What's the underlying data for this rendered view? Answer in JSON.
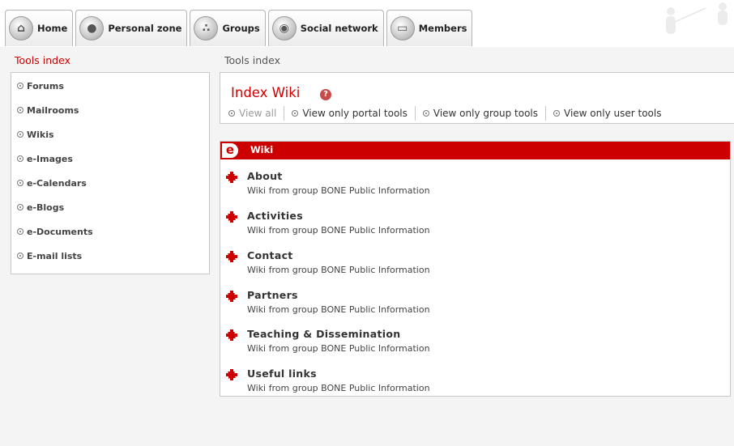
{
  "nav": {
    "tabs": [
      {
        "label": "Home",
        "icon": "home-icon"
      },
      {
        "label": "Personal zone",
        "icon": "user-icon"
      },
      {
        "label": "Groups",
        "icon": "groups-icon"
      },
      {
        "label": "Social network",
        "icon": "network-icon"
      },
      {
        "label": "Members",
        "icon": "members-icon"
      }
    ]
  },
  "sidebar": {
    "title": "Tools index",
    "items": [
      {
        "label": "Forums"
      },
      {
        "label": "Mailrooms"
      },
      {
        "label": "Wikis"
      },
      {
        "label": "e-Images"
      },
      {
        "label": "e-Calendars"
      },
      {
        "label": "e-Blogs"
      },
      {
        "label": "e-Documents"
      },
      {
        "label": "E-mail lists"
      }
    ]
  },
  "breadcrumb": "Tools index",
  "header": {
    "title": "Index Wiki",
    "help_glyph": "?",
    "filters": [
      {
        "label": "View all"
      },
      {
        "label": "View only portal tools"
      },
      {
        "label": "View only group tools"
      },
      {
        "label": "View only user tools"
      }
    ]
  },
  "list": {
    "logo": "e",
    "title": "Wiki",
    "entries": [
      {
        "title": "About",
        "desc": "Wiki from group BONE Public Information"
      },
      {
        "title": "Activities",
        "desc": "Wiki from group BONE Public Information"
      },
      {
        "title": "Contact",
        "desc": "Wiki from group BONE Public Information"
      },
      {
        "title": "Partners",
        "desc": "Wiki from group BONE Public Information"
      },
      {
        "title": "Teaching & Dissemination",
        "desc": "Wiki from group BONE Public Information"
      },
      {
        "title": "Useful links",
        "desc": "Wiki from group BONE Public Information"
      }
    ]
  },
  "colors": {
    "accent": "#cc0000",
    "background": "#f4f4f4",
    "panel": "#ffffff",
    "border": "#c8c8c8"
  }
}
